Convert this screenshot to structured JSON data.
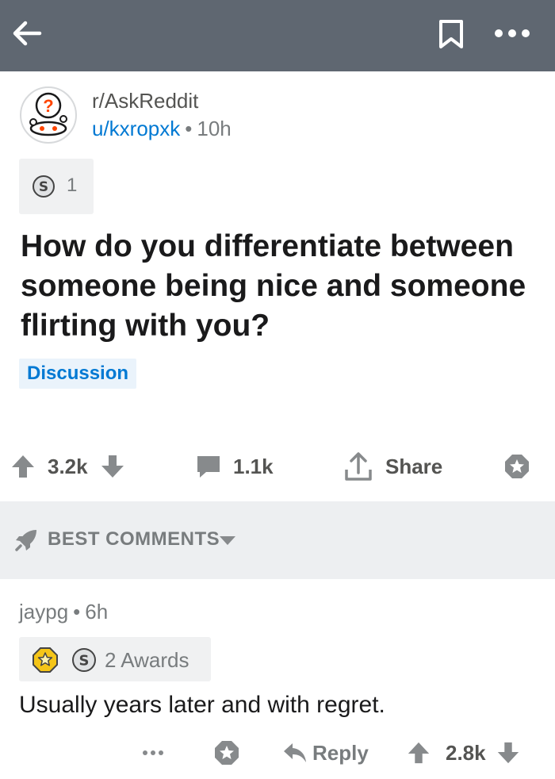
{
  "topbar": {
    "back_icon": "back-arrow-icon",
    "bookmark_icon": "bookmark-icon",
    "more_icon": "more-dots-icon",
    "background": "#5f6771"
  },
  "post": {
    "subreddit": "r/AskReddit",
    "username": "u/kxropxk",
    "separator": "•",
    "age": "10h",
    "award_icon": "silver-award-icon",
    "award_count": "1",
    "title": "How do you differentiate between someone being nice and someone flirting with you?",
    "flair": "Discussion",
    "upvotes": "3.2k",
    "comments": "1.1k",
    "share_label": "Share"
  },
  "comments_header": {
    "label": "BEST COMMENTS"
  },
  "comment": {
    "author": "jaypg",
    "separator": "•",
    "age": "6h",
    "awards_label": "2 Awards",
    "body": "Usually years later and with regret.",
    "reply_label": "Reply",
    "score": "2.8k"
  },
  "colors": {
    "link_blue": "#0079d3",
    "muted": "#787c7e",
    "band": "#edeff1",
    "text": "#1a1a1b"
  }
}
